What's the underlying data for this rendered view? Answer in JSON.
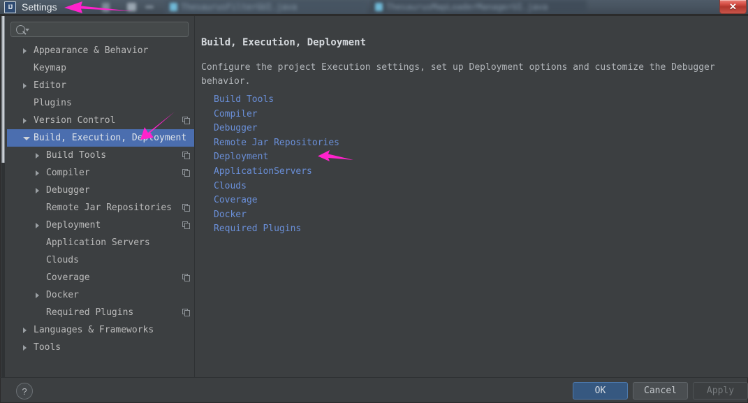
{
  "window": {
    "app_icon": "intellij-logo-icon",
    "title": "Settings",
    "close_label": "✕"
  },
  "search": {
    "value": "",
    "placeholder": ""
  },
  "sidebar": {
    "items": [
      {
        "label": "Appearance & Behavior",
        "level": 0,
        "twisty": "collapsed",
        "copy": false
      },
      {
        "label": "Keymap",
        "level": 0,
        "twisty": "none",
        "copy": false
      },
      {
        "label": "Editor",
        "level": 0,
        "twisty": "collapsed",
        "copy": false
      },
      {
        "label": "Plugins",
        "level": 0,
        "twisty": "none",
        "copy": false
      },
      {
        "label": "Version Control",
        "level": 0,
        "twisty": "collapsed",
        "copy": true
      },
      {
        "label": "Build, Execution, Deployment",
        "level": 0,
        "twisty": "expanded",
        "copy": false,
        "selected": true
      },
      {
        "label": "Build Tools",
        "level": 1,
        "twisty": "collapsed",
        "copy": true
      },
      {
        "label": "Compiler",
        "level": 1,
        "twisty": "collapsed",
        "copy": true
      },
      {
        "label": "Debugger",
        "level": 1,
        "twisty": "collapsed",
        "copy": false
      },
      {
        "label": "Remote Jar Repositories",
        "level": 1,
        "twisty": "none",
        "copy": true
      },
      {
        "label": "Deployment",
        "level": 1,
        "twisty": "collapsed",
        "copy": true
      },
      {
        "label": "Application Servers",
        "level": 1,
        "twisty": "none",
        "copy": false
      },
      {
        "label": "Clouds",
        "level": 1,
        "twisty": "none",
        "copy": false
      },
      {
        "label": "Coverage",
        "level": 1,
        "twisty": "none",
        "copy": true
      },
      {
        "label": "Docker",
        "level": 1,
        "twisty": "collapsed",
        "copy": false
      },
      {
        "label": "Required Plugins",
        "level": 1,
        "twisty": "none",
        "copy": true
      },
      {
        "label": "Languages & Frameworks",
        "level": 0,
        "twisty": "collapsed",
        "copy": false
      },
      {
        "label": "Tools",
        "level": 0,
        "twisty": "collapsed",
        "copy": false
      }
    ]
  },
  "content": {
    "title": "Build, Execution, Deployment",
    "description": "Configure the project Execution settings, set up Deployment options and customize the Debugger behavior.",
    "links": [
      "Build Tools",
      "Compiler",
      "Debugger",
      "Remote Jar Repositories",
      "Deployment",
      "ApplicationServers",
      "Clouds",
      "Coverage",
      "Docker",
      "Required Plugins"
    ]
  },
  "footer": {
    "help_label": "?",
    "ok_label": "OK",
    "cancel_label": "Cancel",
    "apply_label": "Apply"
  },
  "annotations": {
    "color": "#ff22cc",
    "arrows": [
      {
        "name": "arrow-to-settings-title",
        "points_to": "Settings"
      },
      {
        "name": "arrow-to-build-execution",
        "points_to": "Build, Execution, Deployment"
      },
      {
        "name": "arrow-to-application-servers-link",
        "points_to": "ApplicationServers"
      }
    ]
  },
  "theme": {
    "background": "#3c3f41",
    "selection": "#4b6eaf",
    "link": "#6a8fd8",
    "accent_ok": "#365880"
  }
}
